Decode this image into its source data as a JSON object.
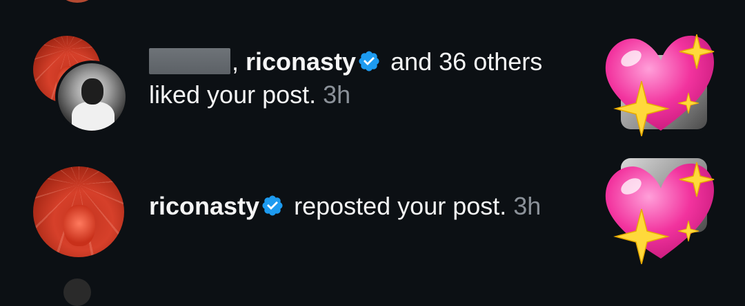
{
  "notifications": [
    {
      "actor_name": "riconasty",
      "suffix_text": " and 36 others",
      "line2_text": "liked your post.",
      "time": "3h"
    },
    {
      "actor_name": "riconasty",
      "suffix_text": " reposted your post.",
      "time": "3h"
    }
  ],
  "icons": {
    "verified": "verified-badge-icon",
    "thumbnail": "sparkling-heart-emoji"
  },
  "colors": {
    "background": "#0c1014",
    "verified_blue": "#1d9bf0",
    "timestamp_gray": "#8b9199"
  }
}
